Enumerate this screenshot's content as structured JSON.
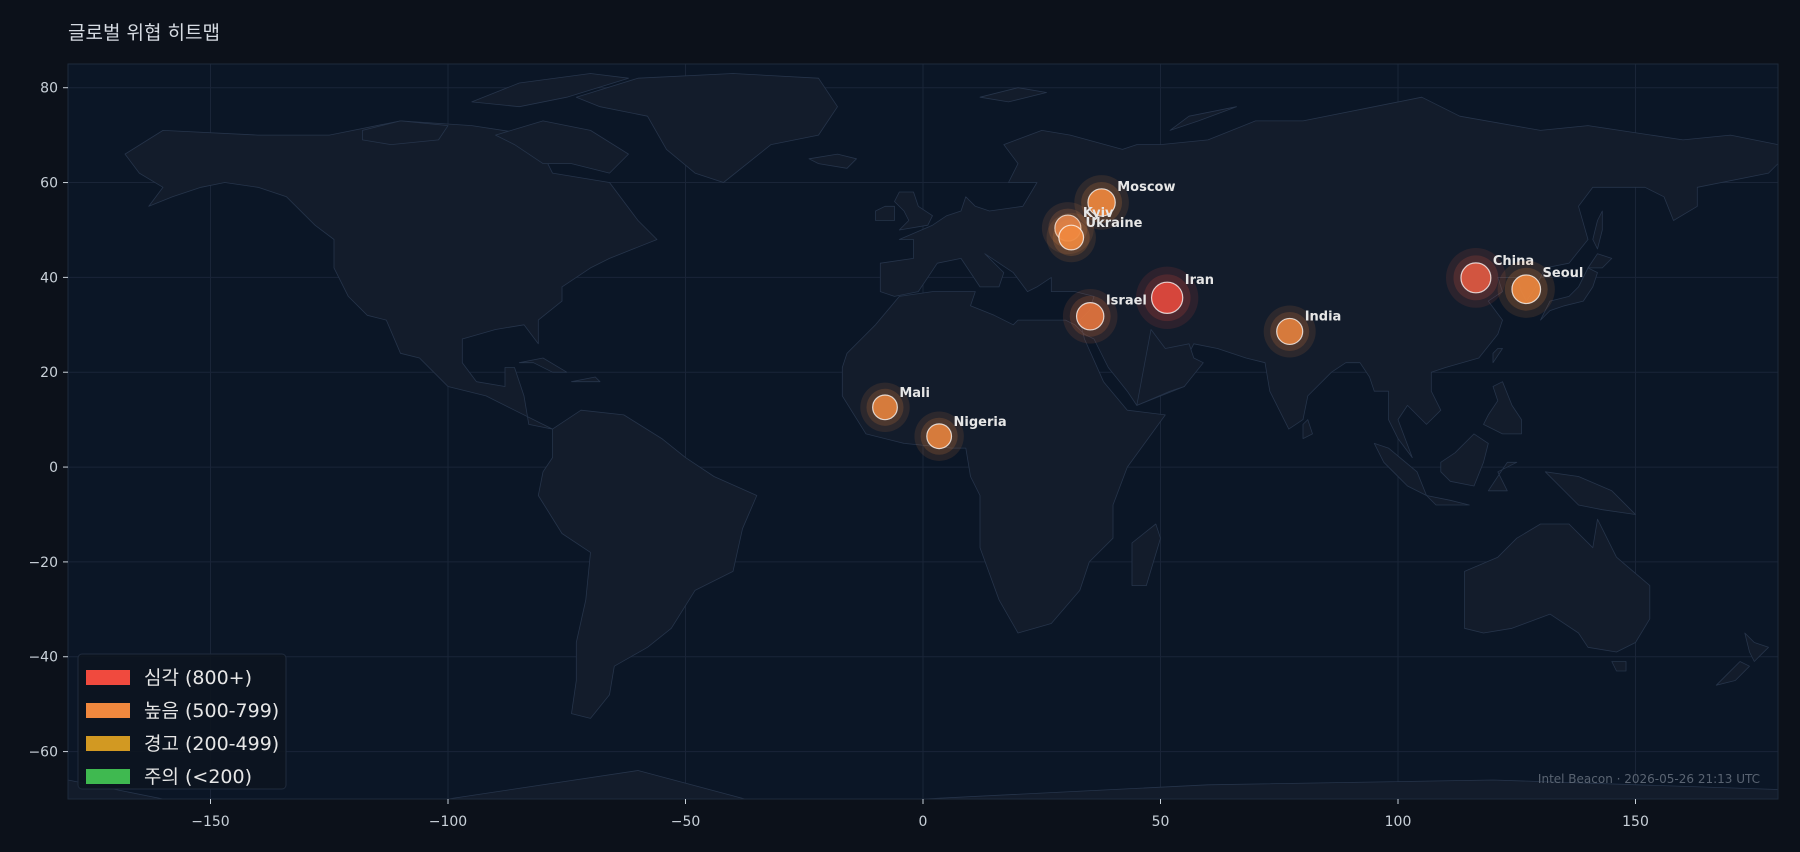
{
  "page": {
    "title": "글로벌 위협 히트맵"
  },
  "colors": {
    "background": "#0c111a",
    "ocean": "#0b1626",
    "land": "#131c2b",
    "land_border": "#26344a",
    "grid": "#1a2538",
    "critical": "#f04a3e",
    "high": "#f0883e",
    "warning": "#d29922",
    "caution": "#3fb950"
  },
  "chart_data": {
    "type": "scatter",
    "xlim": [
      -180,
      180
    ],
    "ylim": [
      -70,
      85
    ],
    "x_ticks": [
      -150,
      -100,
      -50,
      0,
      50,
      100,
      150
    ],
    "x_tick_labels": [
      "−150",
      "−100",
      "−50",
      "0",
      "50",
      "100",
      "150"
    ],
    "y_ticks": [
      80,
      60,
      40,
      20,
      0,
      -20,
      -40,
      -60
    ],
    "y_tick_labels": [
      "80",
      "60",
      "40",
      "20",
      "0",
      "−20",
      "−40",
      "−60"
    ],
    "grid": true,
    "legend": {
      "position": "bottom-left",
      "items": [
        {
          "label": "심각 (800+)",
          "color": "#f04a3e"
        },
        {
          "label": "높음 (500-799)",
          "color": "#f0883e"
        },
        {
          "label": "경고 (200-499)",
          "color": "#d29922"
        },
        {
          "label": "주의 (<200)",
          "color": "#3fb950"
        }
      ]
    },
    "points": [
      {
        "name": "Moscow",
        "lon": 37.6,
        "lat": 55.8,
        "color": "#f0883e",
        "size": 1.05
      },
      {
        "name": "Kyiv",
        "lon": 30.5,
        "lat": 50.4,
        "color": "#e3834a",
        "size": 1.0
      },
      {
        "name": "Ukraine",
        "lon": 31.2,
        "lat": 48.4,
        "color": "#f0883e",
        "size": 0.95
      },
      {
        "name": "Iran",
        "lon": 51.4,
        "lat": 35.7,
        "color": "#e5493e",
        "size": 1.2
      },
      {
        "name": "Israel",
        "lon": 35.2,
        "lat": 31.8,
        "color": "#e3743e",
        "size": 1.05
      },
      {
        "name": "India",
        "lon": 77.2,
        "lat": 28.6,
        "color": "#e6823e",
        "size": 1.0
      },
      {
        "name": "China",
        "lon": 116.4,
        "lat": 39.9,
        "color": "#e15a43",
        "size": 1.15
      },
      {
        "name": "Seoul",
        "lon": 127.0,
        "lat": 37.5,
        "color": "#f0883e",
        "size": 1.1
      },
      {
        "name": "Mali",
        "lon": -8.0,
        "lat": 12.6,
        "color": "#e6833e",
        "size": 0.95
      },
      {
        "name": "Nigeria",
        "lon": 3.4,
        "lat": 6.5,
        "color": "#e6833e",
        "size": 0.95
      }
    ]
  },
  "footer": {
    "note": "Intel Beacon · 2026-05-26 21:13 UTC"
  }
}
